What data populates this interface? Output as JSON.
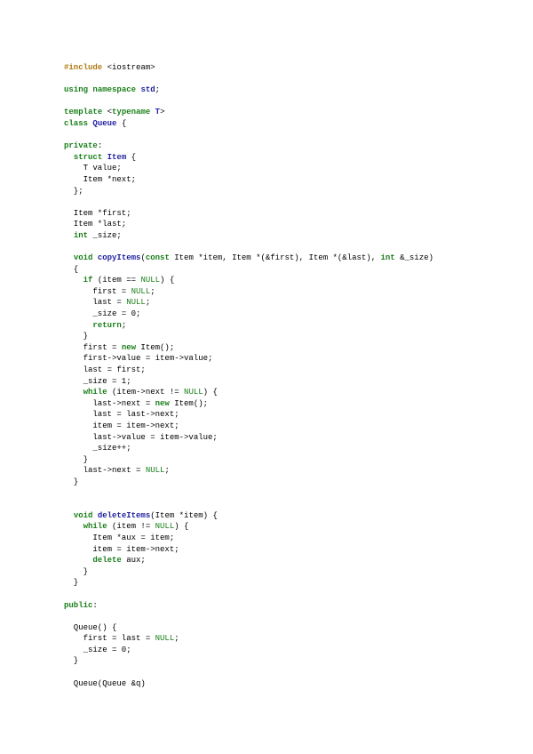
{
  "document": {
    "language": "C++",
    "lines": [
      [
        {
          "t": "pp",
          "s": "#include"
        },
        {
          "t": "plain",
          "s": " <iostream>"
        }
      ],
      [],
      [
        {
          "t": "kw",
          "s": "using"
        },
        {
          "t": "plain",
          "s": " "
        },
        {
          "t": "kw",
          "s": "namespace"
        },
        {
          "t": "plain",
          "s": " "
        },
        {
          "t": "type",
          "s": "std"
        },
        {
          "t": "plain",
          "s": ";"
        }
      ],
      [],
      [
        {
          "t": "kw",
          "s": "template"
        },
        {
          "t": "plain",
          "s": " <"
        },
        {
          "t": "kw",
          "s": "typename"
        },
        {
          "t": "plain",
          "s": " "
        },
        {
          "t": "type",
          "s": "T"
        },
        {
          "t": "plain",
          "s": ">"
        }
      ],
      [
        {
          "t": "kw",
          "s": "class"
        },
        {
          "t": "plain",
          "s": " "
        },
        {
          "t": "type",
          "s": "Queue"
        },
        {
          "t": "plain",
          "s": " {"
        }
      ],
      [],
      [
        {
          "t": "kw",
          "s": "private"
        },
        {
          "t": "plain",
          "s": ":"
        }
      ],
      [
        {
          "t": "plain",
          "s": "  "
        },
        {
          "t": "kw",
          "s": "struct"
        },
        {
          "t": "plain",
          "s": " "
        },
        {
          "t": "type",
          "s": "Item"
        },
        {
          "t": "plain",
          "s": " {"
        }
      ],
      [
        {
          "t": "plain",
          "s": "    T value;"
        }
      ],
      [
        {
          "t": "plain",
          "s": "    Item *next;"
        }
      ],
      [
        {
          "t": "plain",
          "s": "  };"
        }
      ],
      [],
      [
        {
          "t": "plain",
          "s": "  Item *first;"
        }
      ],
      [
        {
          "t": "plain",
          "s": "  Item *last;"
        }
      ],
      [
        {
          "t": "plain",
          "s": "  "
        },
        {
          "t": "kw",
          "s": "int"
        },
        {
          "t": "plain",
          "s": " _size;"
        }
      ],
      [],
      [
        {
          "t": "plain",
          "s": "  "
        },
        {
          "t": "kw",
          "s": "void"
        },
        {
          "t": "plain",
          "s": " "
        },
        {
          "t": "fn",
          "s": "copyItems"
        },
        {
          "t": "plain",
          "s": "("
        },
        {
          "t": "kw",
          "s": "const"
        },
        {
          "t": "plain",
          "s": " Item *item, Item *(&first), Item *(&last), "
        },
        {
          "t": "kw",
          "s": "int"
        },
        {
          "t": "plain",
          "s": " &_size)"
        }
      ],
      [
        {
          "t": "plain",
          "s": "  {"
        }
      ],
      [
        {
          "t": "plain",
          "s": "    "
        },
        {
          "t": "kw",
          "s": "if"
        },
        {
          "t": "plain",
          "s": " (item == "
        },
        {
          "t": "lit",
          "s": "NULL"
        },
        {
          "t": "plain",
          "s": ") {"
        }
      ],
      [
        {
          "t": "plain",
          "s": "      first = "
        },
        {
          "t": "lit",
          "s": "NULL"
        },
        {
          "t": "plain",
          "s": ";"
        }
      ],
      [
        {
          "t": "plain",
          "s": "      last = "
        },
        {
          "t": "lit",
          "s": "NULL"
        },
        {
          "t": "plain",
          "s": ";"
        }
      ],
      [
        {
          "t": "plain",
          "s": "      _size = 0;"
        }
      ],
      [
        {
          "t": "plain",
          "s": "      "
        },
        {
          "t": "kw",
          "s": "return"
        },
        {
          "t": "plain",
          "s": ";"
        }
      ],
      [
        {
          "t": "plain",
          "s": "    }"
        }
      ],
      [
        {
          "t": "plain",
          "s": "    first = "
        },
        {
          "t": "kw",
          "s": "new"
        },
        {
          "t": "plain",
          "s": " Item();"
        }
      ],
      [
        {
          "t": "plain",
          "s": "    first->value = item->value;"
        }
      ],
      [
        {
          "t": "plain",
          "s": "    last = first;"
        }
      ],
      [
        {
          "t": "plain",
          "s": "    _size = 1;"
        }
      ],
      [
        {
          "t": "plain",
          "s": "    "
        },
        {
          "t": "kw",
          "s": "while"
        },
        {
          "t": "plain",
          "s": " (item->next != "
        },
        {
          "t": "lit",
          "s": "NULL"
        },
        {
          "t": "plain",
          "s": ") {"
        }
      ],
      [
        {
          "t": "plain",
          "s": "      last->next = "
        },
        {
          "t": "kw",
          "s": "new"
        },
        {
          "t": "plain",
          "s": " Item();"
        }
      ],
      [
        {
          "t": "plain",
          "s": "      last = last->next;"
        }
      ],
      [
        {
          "t": "plain",
          "s": "      item = item->next;"
        }
      ],
      [
        {
          "t": "plain",
          "s": "      last->value = item->value;"
        }
      ],
      [
        {
          "t": "plain",
          "s": "      _size++;"
        }
      ],
      [
        {
          "t": "plain",
          "s": "    }"
        }
      ],
      [
        {
          "t": "plain",
          "s": "    last->next = "
        },
        {
          "t": "lit",
          "s": "NULL"
        },
        {
          "t": "plain",
          "s": ";"
        }
      ],
      [
        {
          "t": "plain",
          "s": "  }"
        }
      ],
      [],
      [],
      [
        {
          "t": "plain",
          "s": "  "
        },
        {
          "t": "kw",
          "s": "void"
        },
        {
          "t": "plain",
          "s": " "
        },
        {
          "t": "fn",
          "s": "deleteItems"
        },
        {
          "t": "plain",
          "s": "(Item *item) {"
        }
      ],
      [
        {
          "t": "plain",
          "s": "    "
        },
        {
          "t": "kw",
          "s": "while"
        },
        {
          "t": "plain",
          "s": " (item != "
        },
        {
          "t": "lit",
          "s": "NULL"
        },
        {
          "t": "plain",
          "s": ") {"
        }
      ],
      [
        {
          "t": "plain",
          "s": "      Item *aux = item;"
        }
      ],
      [
        {
          "t": "plain",
          "s": "      item = item->next;"
        }
      ],
      [
        {
          "t": "plain",
          "s": "      "
        },
        {
          "t": "kw",
          "s": "delete"
        },
        {
          "t": "plain",
          "s": " aux;"
        }
      ],
      [
        {
          "t": "plain",
          "s": "    }"
        }
      ],
      [
        {
          "t": "plain",
          "s": "  }"
        }
      ],
      [],
      [
        {
          "t": "kw",
          "s": "public"
        },
        {
          "t": "plain",
          "s": ":"
        }
      ],
      [],
      [
        {
          "t": "plain",
          "s": "  Queue() {"
        }
      ],
      [
        {
          "t": "plain",
          "s": "    first = last = "
        },
        {
          "t": "lit",
          "s": "NULL"
        },
        {
          "t": "plain",
          "s": ";"
        }
      ],
      [
        {
          "t": "plain",
          "s": "    _size = 0;"
        }
      ],
      [
        {
          "t": "plain",
          "s": "  }"
        }
      ],
      [],
      [
        {
          "t": "plain",
          "s": "  Queue(Queue &q)"
        }
      ]
    ]
  },
  "colors": {
    "keyword": "#1a7f1a",
    "type": "#1f1fa0",
    "preprocessor": "#b07a12",
    "literal": "#1a7f1a",
    "text": "#000000",
    "background": "#ffffff"
  }
}
